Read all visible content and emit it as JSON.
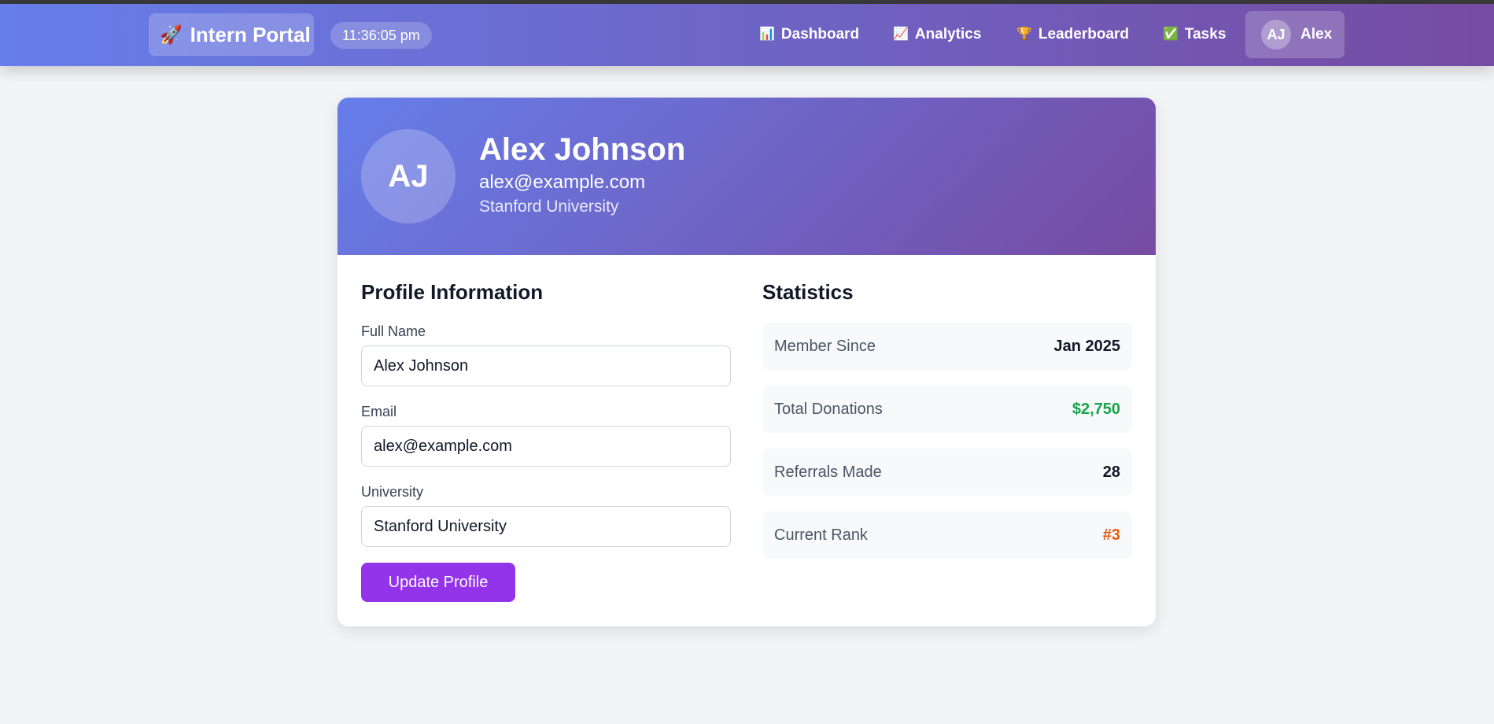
{
  "nav": {
    "brand_icon": "rocket-icon",
    "brand_glyph": "🚀",
    "brand": "Intern Portal",
    "clock": "11:36:05 pm",
    "items": [
      {
        "glyph": "📊",
        "icon": "bar-chart-icon",
        "label": "Dashboard"
      },
      {
        "glyph": "📈",
        "icon": "trend-chart-icon",
        "label": "Analytics"
      },
      {
        "glyph": "🏆",
        "icon": "trophy-icon",
        "label": "Leaderboard"
      },
      {
        "glyph": "✅",
        "icon": "check-box-icon",
        "label": "Tasks"
      }
    ],
    "user_initials": "AJ",
    "user_name": "Alex"
  },
  "profile": {
    "initials": "AJ",
    "name": "Alex Johnson",
    "email": "alex@example.com",
    "university": "Stanford University"
  },
  "form": {
    "title": "Profile Information",
    "full_name_label": "Full Name",
    "full_name_value": "Alex Johnson",
    "email_label": "Email",
    "email_value": "alex@example.com",
    "university_label": "University",
    "university_value": "Stanford University",
    "submit_label": "Update Profile"
  },
  "stats": {
    "title": "Statistics",
    "rows": [
      {
        "label": "Member Since",
        "value": "Jan 2025",
        "color": "#111827"
      },
      {
        "label": "Total Donations",
        "value": "$2,750",
        "color": "#16a34a"
      },
      {
        "label": "Referrals Made",
        "value": "28",
        "color": "#111827"
      },
      {
        "label": "Current Rank",
        "value": "#3",
        "color": "#ea580c"
      }
    ]
  },
  "colors": {
    "gradient_start": "#667eea",
    "gradient_end": "#764ba2",
    "button": "#9333ea"
  }
}
